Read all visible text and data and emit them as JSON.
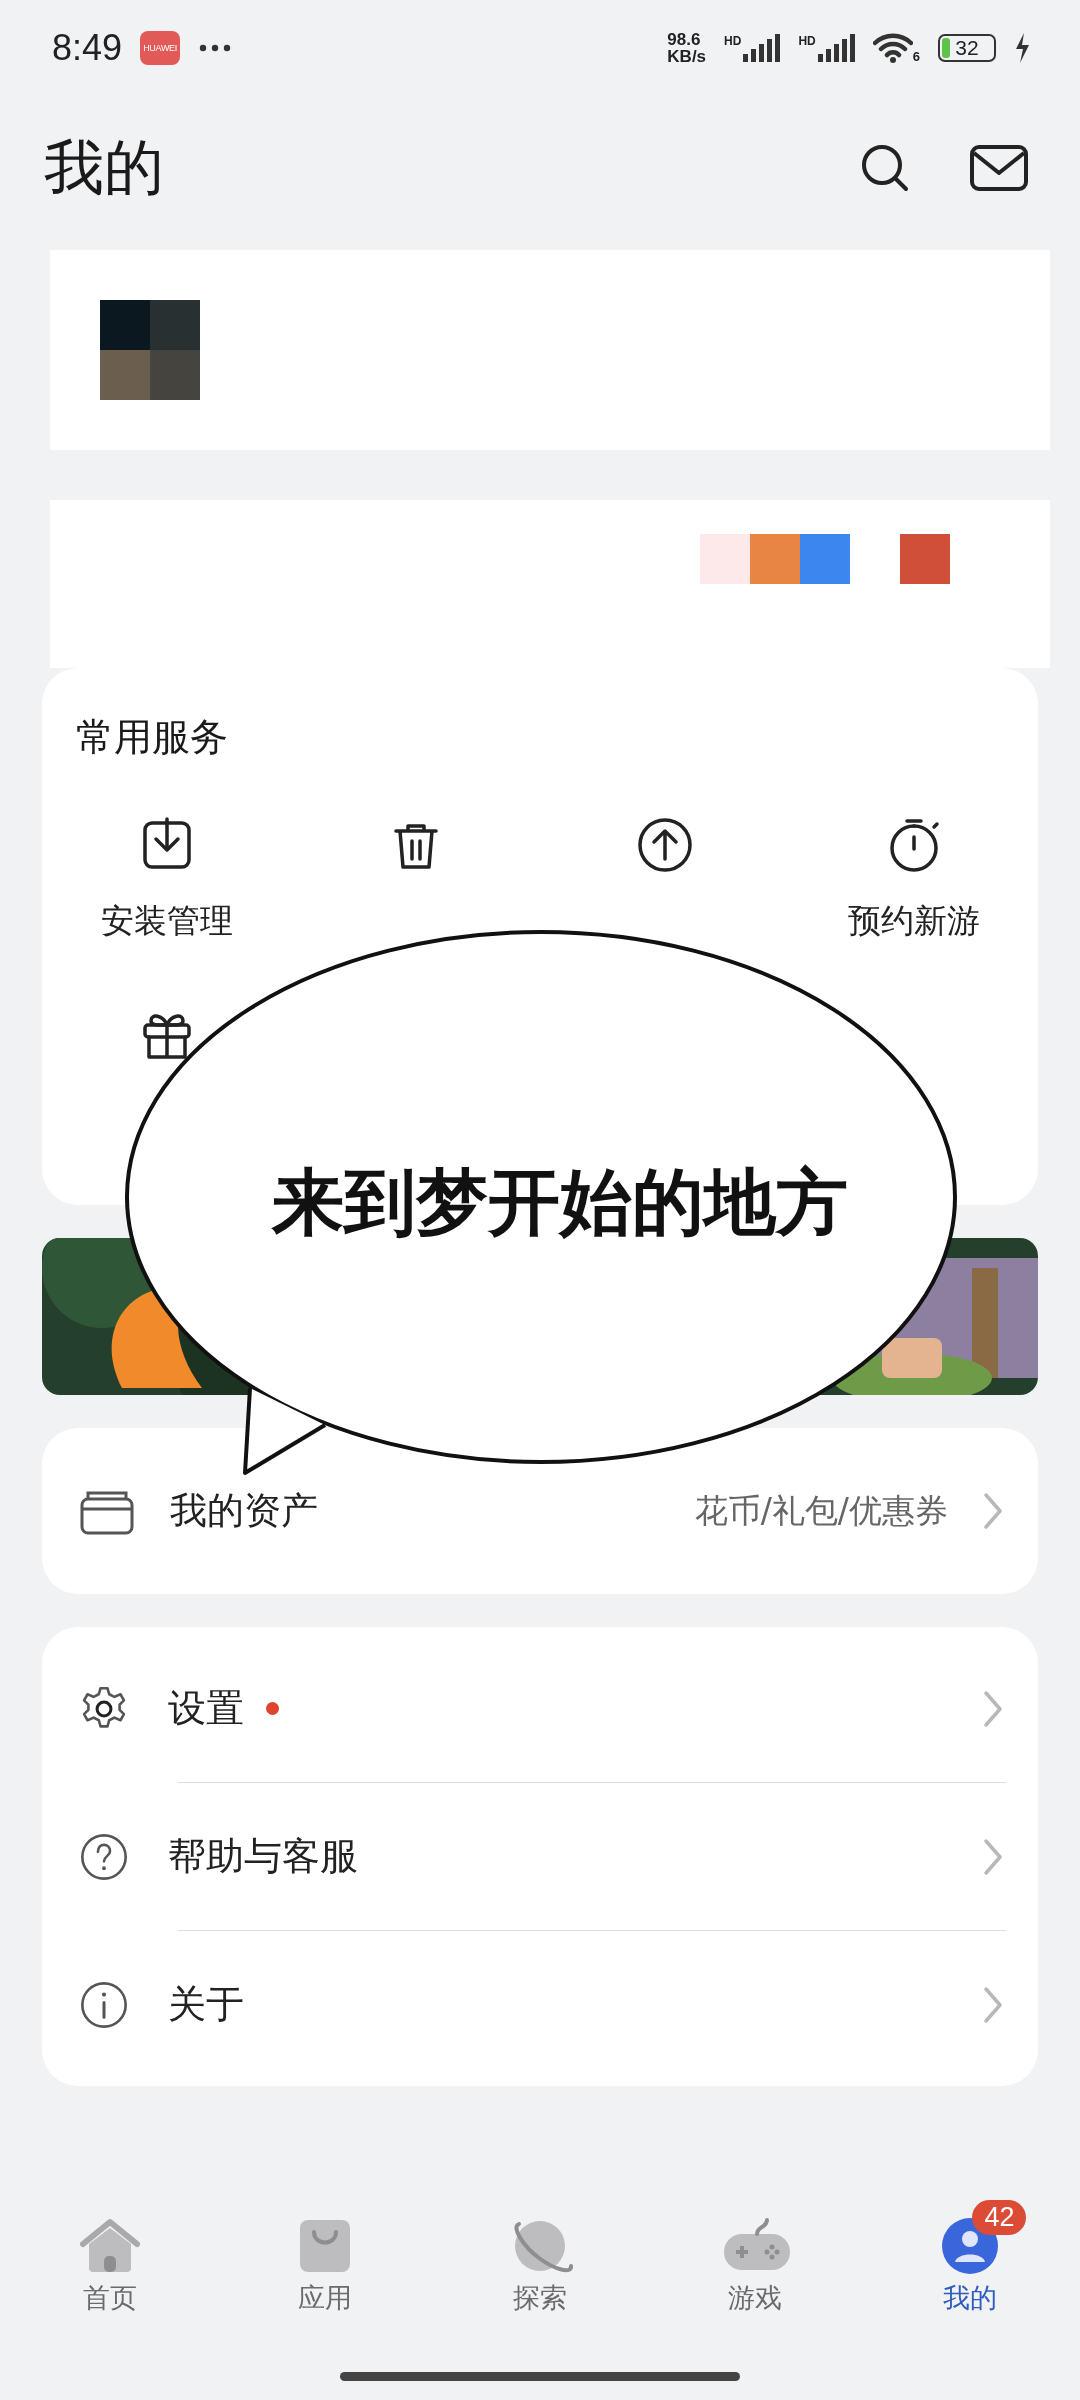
{
  "status_bar": {
    "time": "8:49",
    "app_icon_text": "HUAWEI",
    "speed_value": "98.6",
    "speed_unit": "KB/s",
    "sim_labels": [
      "HD",
      "HD"
    ],
    "wifi_label": "6",
    "battery": "32"
  },
  "header": {
    "title": "我的"
  },
  "services": {
    "title": "常用服务",
    "items": [
      {
        "kind": "install",
        "label": "安装管理"
      },
      {
        "kind": "uninstall"
      },
      {
        "kind": "update"
      },
      {
        "kind": "reserve",
        "label": "预约新游"
      },
      {
        "kind": "gift"
      }
    ]
  },
  "speech_bubble": {
    "text": "来到梦开始的地方"
  },
  "assets": {
    "label": "我的资产",
    "detail": "花币/礼包/优惠券"
  },
  "menu": [
    {
      "kind": "settings",
      "label": "设置",
      "dot": true
    },
    {
      "kind": "help",
      "label": "帮助与客服",
      "dot": false
    },
    {
      "kind": "about",
      "label": "关于",
      "dot": false
    }
  ],
  "bottom_nav": [
    {
      "kind": "home",
      "label": "首页",
      "selected": false
    },
    {
      "kind": "apps",
      "label": "应用",
      "selected": false
    },
    {
      "kind": "explore",
      "label": "探索",
      "selected": false
    },
    {
      "kind": "games",
      "label": "游戏",
      "selected": false
    },
    {
      "kind": "me",
      "label": "我的",
      "selected": true,
      "badge": "42"
    }
  ]
}
